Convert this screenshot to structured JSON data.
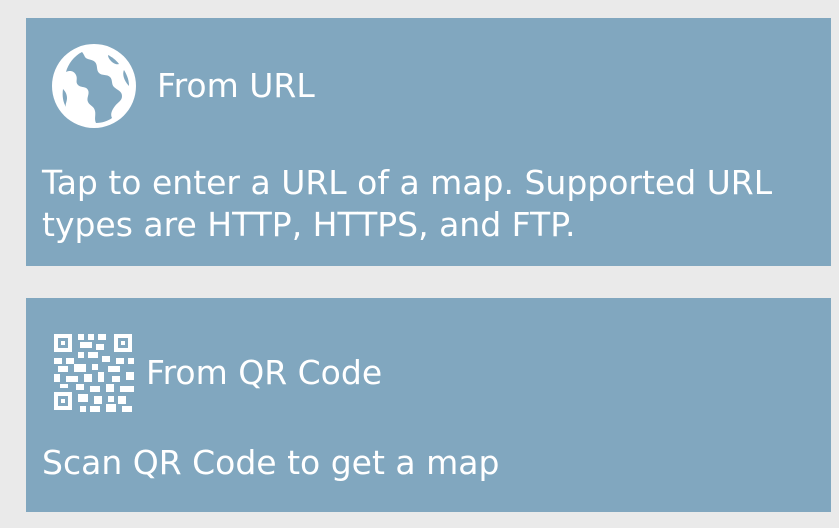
{
  "background_color": "#eaeaea",
  "tile_color": "#81a7bf",
  "text_color": "#ffffff",
  "options": [
    {
      "icon": "globe-icon",
      "title": "From URL",
      "description": "Tap to enter a URL of a map. Supported URL types are HTTP, HTTPS, and FTP."
    },
    {
      "icon": "qr-code-icon",
      "title": "From QR Code",
      "description": "Scan QR Code to get a map"
    }
  ]
}
